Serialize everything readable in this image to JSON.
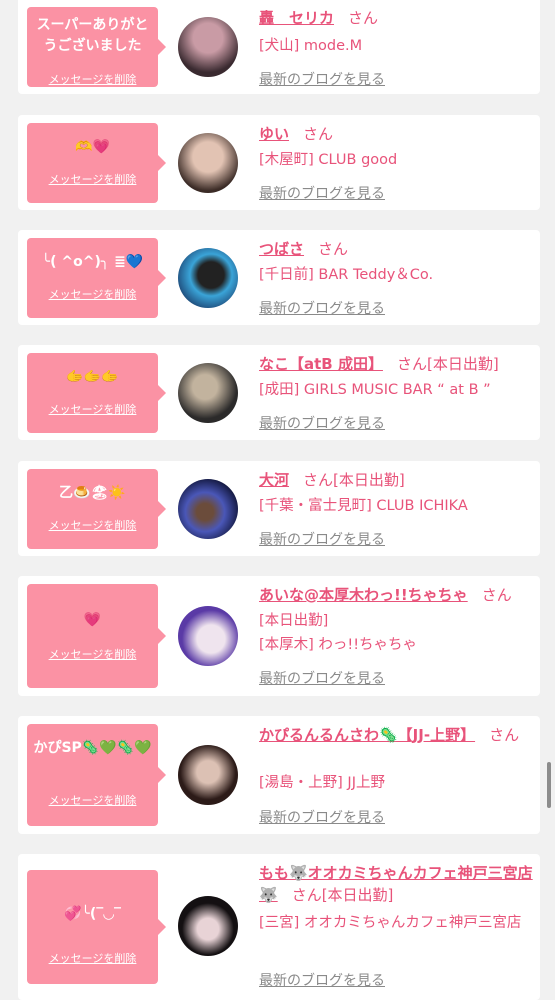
{
  "colors": {
    "accent": "#e8537a",
    "bubble": "#fb92a4",
    "blog_link": "#8a8a8a"
  },
  "items": [
    {
      "message": "スーパーありがとうございました",
      "delete_label": "メッセージを削除",
      "name": "轟　セリカ",
      "honorific": "さん",
      "status": "",
      "shop": "[犬山] mode.M",
      "blog_label": "最新のブログを見る",
      "avatar_colors": [
        "#3a2a30",
        "#c99ba5"
      ]
    },
    {
      "message": "🫶💗",
      "delete_label": "メッセージを削除",
      "name": "ゆい",
      "honorific": "さん",
      "status": "",
      "shop": "[木屋町] CLUB good",
      "blog_label": "最新のブログを見る",
      "avatar_colors": [
        "#3b2b26",
        "#e2c3b3"
      ]
    },
    {
      "message": "╰( ^o^)╮ ≣💙",
      "delete_label": "メッセージを削除",
      "name": "つばさ",
      "honorific": "さん",
      "status": "",
      "shop": "[千日前] BAR Teddy＆Co.",
      "blog_label": "最新のブログを見る",
      "avatar_colors": [
        "#1a3d6b",
        "#3aa4d8"
      ]
    },
    {
      "message": "🫱🫱🫱",
      "delete_label": "メッセージを削除",
      "name": "なこ【atB 成田】",
      "honorific": "さん",
      "status": "[本日出勤]",
      "shop": "[成田] GIRLS MUSIC BAR “ at B ”",
      "blog_label": "最新のブログを見る",
      "avatar_colors": [
        "#2b2a2a",
        "#c2b39e"
      ]
    },
    {
      "message": "乙🍮🏖☀️",
      "delete_label": "メッセージを削除",
      "name": "大河",
      "honorific": "さん",
      "status": "[本日出勤]",
      "shop": "[千葉・富士見町] CLUB ICHIKA",
      "blog_label": "最新のブログを見る",
      "avatar_colors": [
        "#0c1030",
        "#4a57b8"
      ]
    },
    {
      "message": "💗",
      "delete_label": "メッセージを削除",
      "name": "あいな@本厚木わっ!!ちゃちゃ",
      "honorific": "さん",
      "status": "[本日出勤]",
      "shop": "[本厚木] わっ!!ちゃちゃ",
      "blog_label": "最新のブログを見る",
      "avatar_colors": [
        "#5a3aa6",
        "#efe4ee"
      ]
    },
    {
      "message": "かぴSP🦠💚🦠💚",
      "delete_label": "メッセージを削除",
      "name": "かぴるんるんさわ🦠【JJ-上野】",
      "honorific": "さん",
      "status": "",
      "shop": "[湯島・上野] JJ上野",
      "blog_label": "最新のブログを見る",
      "avatar_colors": [
        "#2c1b18",
        "#dcc1b4"
      ]
    },
    {
      "message": "💞╰(‾◡‾",
      "delete_label": "メッセージを削除",
      "name": "もも🐺オオカミちゃんカフェ神戸三宮店🐺",
      "honorific": "さん",
      "status": "[本日出勤]",
      "shop": "[三宮] オオカミちゃんカフェ神戸三宮店",
      "blog_label": "最新のブログを見る",
      "avatar_colors": [
        "#141012",
        "#e8d3d6"
      ]
    }
  ]
}
